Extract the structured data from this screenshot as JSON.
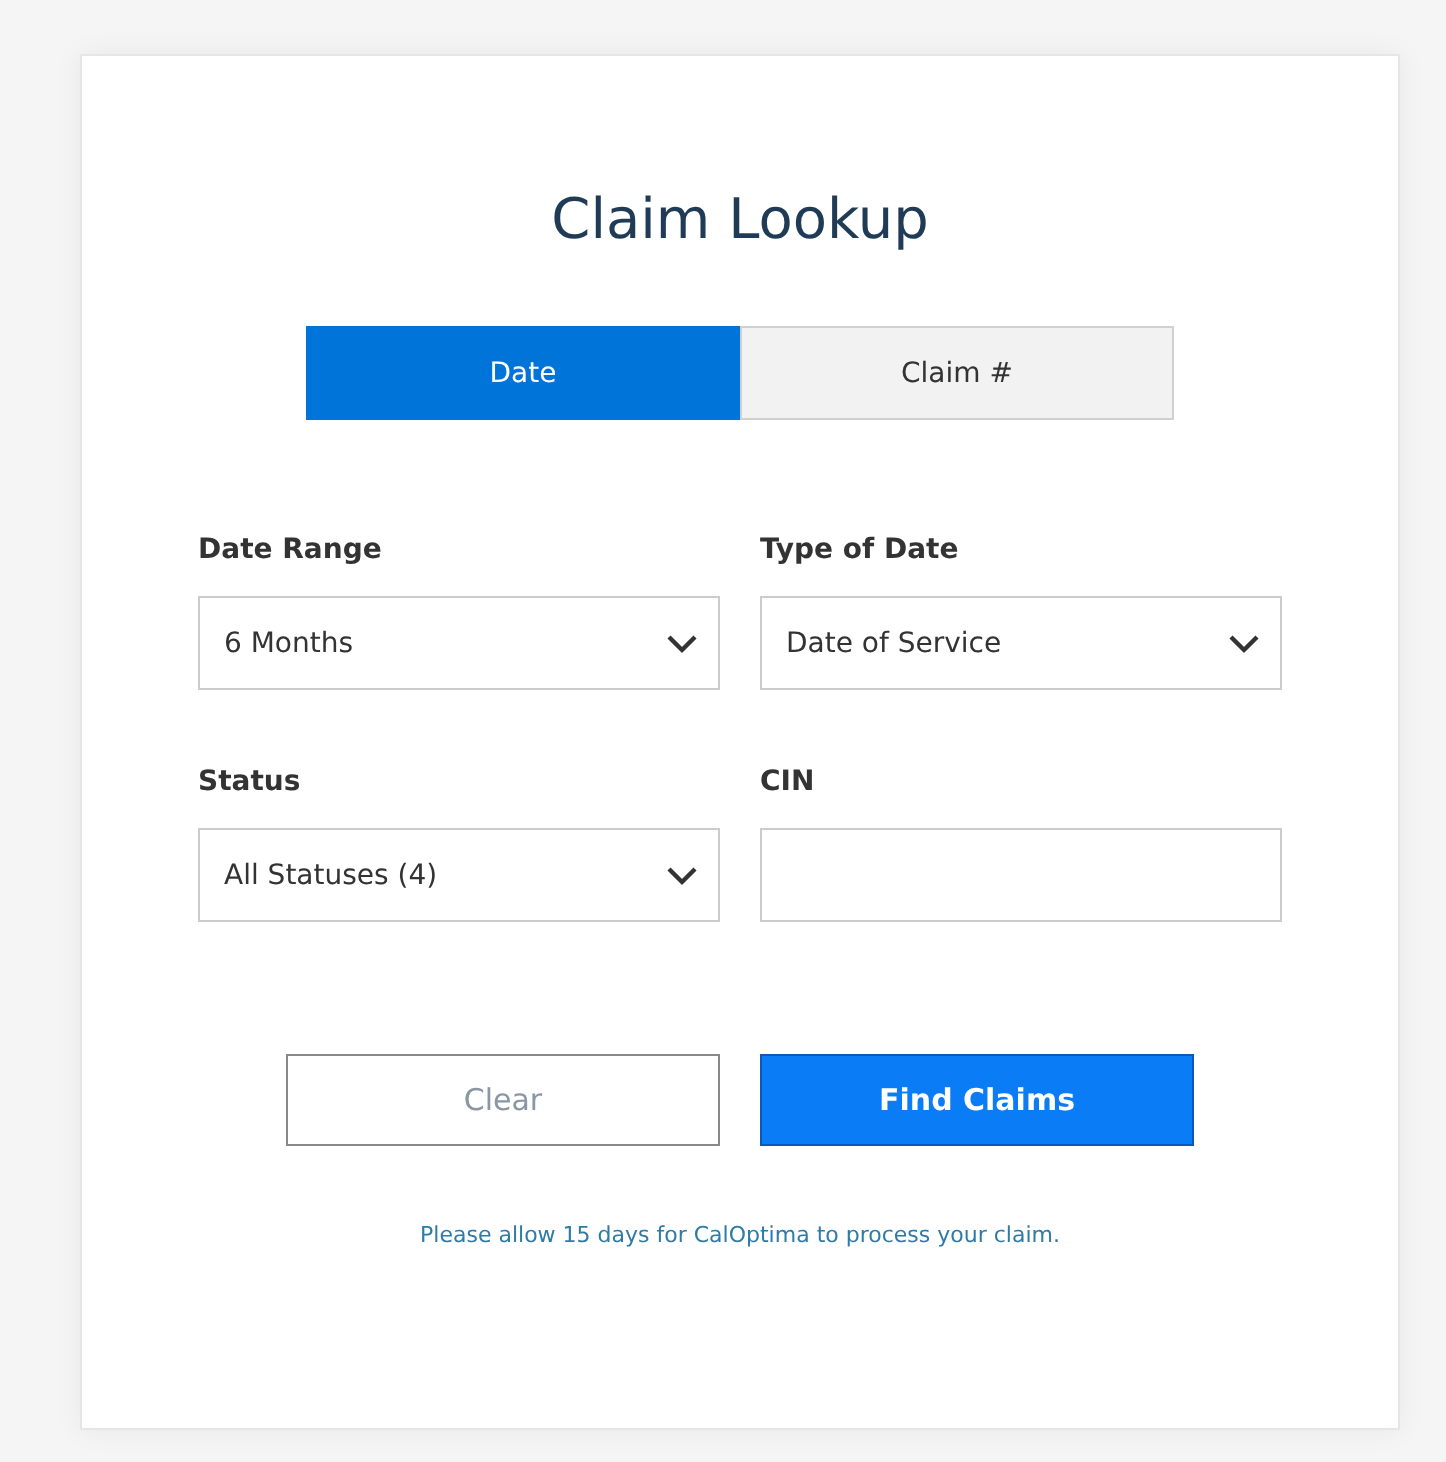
{
  "title": "Claim Lookup",
  "tabs": [
    {
      "label": "Date",
      "selected": true
    },
    {
      "label": "Claim #",
      "selected": false
    }
  ],
  "fields": [
    {
      "label": "Date Range",
      "kind": "select",
      "value": "6 Months"
    },
    {
      "label": "Type of Date",
      "kind": "select",
      "value": "Date of Service"
    },
    {
      "label": "Status",
      "kind": "select",
      "value": "All Statuses (4)"
    },
    {
      "label": "CIN",
      "kind": "text"
    }
  ],
  "buttons": [
    {
      "label": "Clear",
      "kind": "secondary"
    },
    {
      "label": "Find Claims",
      "kind": "primary"
    }
  ],
  "note": "Please allow 15 days for CalOptima to process your claim."
}
